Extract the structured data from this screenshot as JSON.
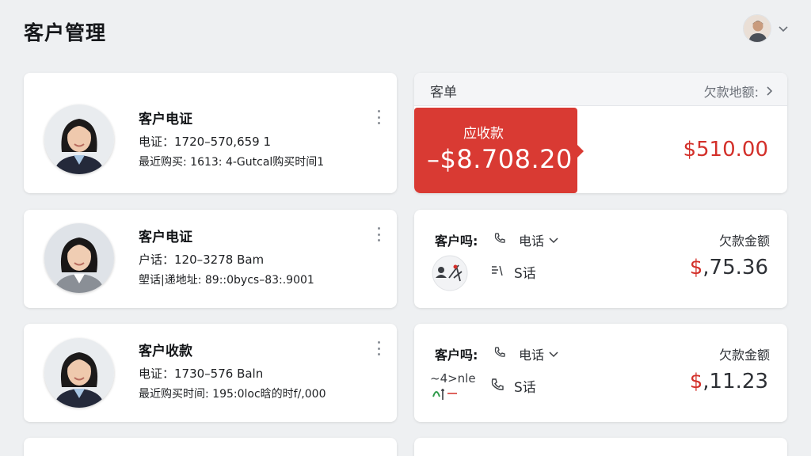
{
  "page": {
    "title": "客户管理"
  },
  "user": {
    "avatar": "avatar-icon",
    "menu_icon": "chevron-down-icon"
  },
  "customers": [
    {
      "name": "客户电证",
      "line1": "电证：1720–570,659 1",
      "line2": "最近购买: 1613: 4-Gutcal​购买时间1"
    },
    {
      "name": "客户电证",
      "line1": "户话：120–3278 Bam",
      "line2": "塱话|递地址: 89::0bycs–83:.9001"
    },
    {
      "name": "客户收款",
      "line1": "电证：1730–576 Baln",
      "line2": "最近购买时间: 195:0loc​​晗的时f/,000"
    }
  ],
  "summary": {
    "title": "客单",
    "link_label": "欠款地额:",
    "receivable_label": "应收款",
    "receivable_value": "–$8.708.20",
    "amount": "$510.00",
    "accent_color": "#d93a33"
  },
  "details": [
    {
      "label": "客户吗:",
      "select": "电话",
      "debt_label": "欠款金额",
      "phone_text": "S话",
      "currency": "$",
      "amount": ",75.36",
      "thumb_text": ""
    },
    {
      "label": "客户吗:",
      "select": "电话",
      "debt_label": "欠款金额",
      "phone_text": "S话",
      "currency": "$",
      "amount": ",11.23",
      "thumb_text": "~4>nle"
    }
  ]
}
